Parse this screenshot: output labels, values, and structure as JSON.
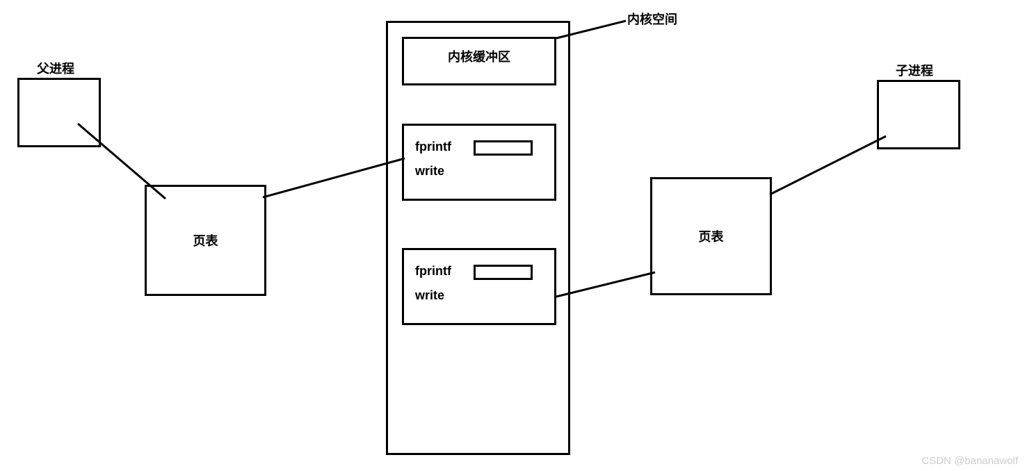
{
  "labels": {
    "parent_process": "父进程",
    "child_process": "子进程",
    "kernel_space": "内核空间",
    "kernel_buffer": "内核缓冲区",
    "page_table_left": "页表",
    "page_table_right": "页表",
    "fprintf1": "fprintf",
    "write1": "write",
    "fprintf2": "fprintf",
    "write2": "write"
  },
  "watermark": "CSDN @bananawolf"
}
